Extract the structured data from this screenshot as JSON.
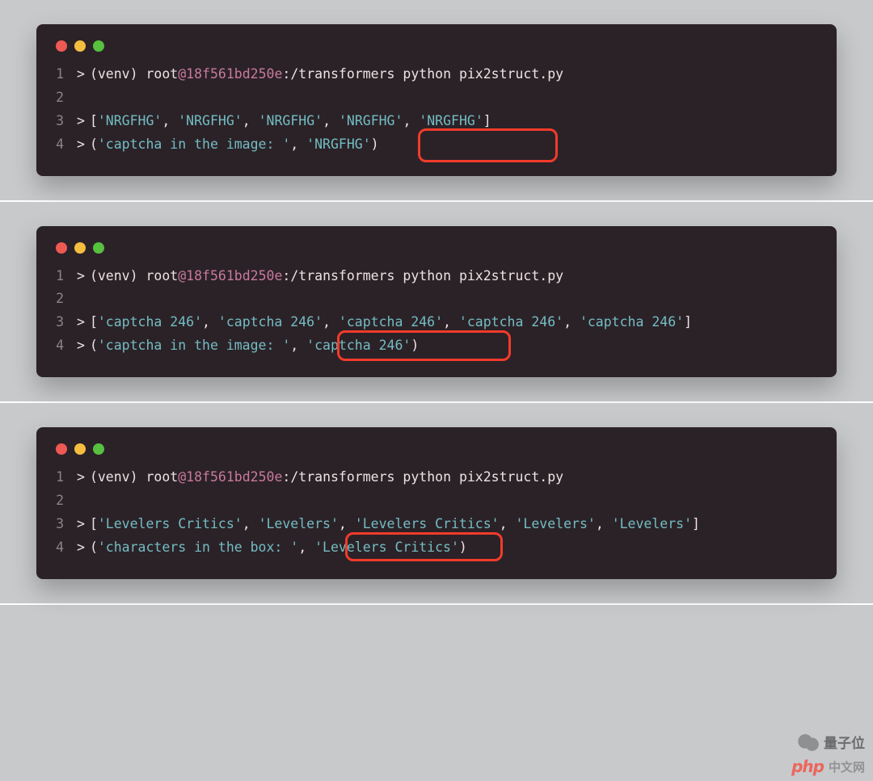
{
  "colors": {
    "dot_red": "#ef5953",
    "dot_yellow": "#f5bd40",
    "dot_green": "#57c03f",
    "terminal_bg": "#2b2228",
    "highlight_border": "#f23b2a"
  },
  "terminals": {
    "t1": {
      "line1": {
        "no": "1",
        "arrow": ">",
        "venv": "(venv) ",
        "root": "root",
        "at": "@",
        "host": "18f561bd250e",
        "colon": ":",
        "path": "/transformers python pix2struct.py"
      },
      "line2": {
        "no": "2"
      },
      "line3": {
        "no": "3",
        "arrow": ">",
        "lbracket": "[",
        "s1": "'NRGFHG'",
        "sep": ", ",
        "s2": "'NRGFHG'",
        "s3": "'NRGFHG'",
        "s4": "'NRGFHG'",
        "s5": "'NRGFHG'",
        "rbracket": "]"
      },
      "line4": {
        "no": "4",
        "arrow": ">",
        "lparen": "(",
        "label": "'captcha in the image: '",
        "sep": ", ",
        "value": "'NRGFHG'",
        "rparen": ")"
      }
    },
    "t2": {
      "line1": {
        "no": "1",
        "arrow": ">",
        "venv": "(venv) ",
        "root": "root",
        "at": "@",
        "host": "18f561bd250e",
        "colon": ":",
        "path": "/transformers python pix2struct.py"
      },
      "line2": {
        "no": "2"
      },
      "line3": {
        "no": "3",
        "arrow": ">",
        "lbracket": "[",
        "s1": "'captcha 246'",
        "sep": ", ",
        "s2": "'captcha 246'",
        "s3": "'captcha 246'",
        "s4": "'captcha 246'",
        "s5": "'captcha 246'",
        "rbracket": "]"
      },
      "line4": {
        "no": "4",
        "arrow": ">",
        "lparen": "(",
        "label": "'captcha in the image: '",
        "sep": ", ",
        "value": "'captcha 246'",
        "rparen": ")"
      }
    },
    "t3": {
      "line1": {
        "no": "1",
        "arrow": ">",
        "venv": "(venv) ",
        "root": "root",
        "at": "@",
        "host": "18f561bd250e",
        "colon": ":",
        "path": "/transformers python pix2struct.py"
      },
      "line2": {
        "no": "2"
      },
      "line3": {
        "no": "3",
        "arrow": ">",
        "lbracket": "[",
        "s1": "'Levelers Critics'",
        "sep": ", ",
        "s2": "'Levelers'",
        "s3": "'Levelers Critics'",
        "s4": "'Levelers'",
        "s5": "'Levelers'",
        "rbracket": "]"
      },
      "line4": {
        "no": "4",
        "arrow": ">",
        "lparen": "(",
        "label": "'characters in the box: '",
        "sep": ", ",
        "value": "'Levelers Critics'",
        "rparen": ")"
      }
    }
  },
  "watermark": {
    "brand": "量子位",
    "php": "php",
    "cn": "中文网"
  }
}
